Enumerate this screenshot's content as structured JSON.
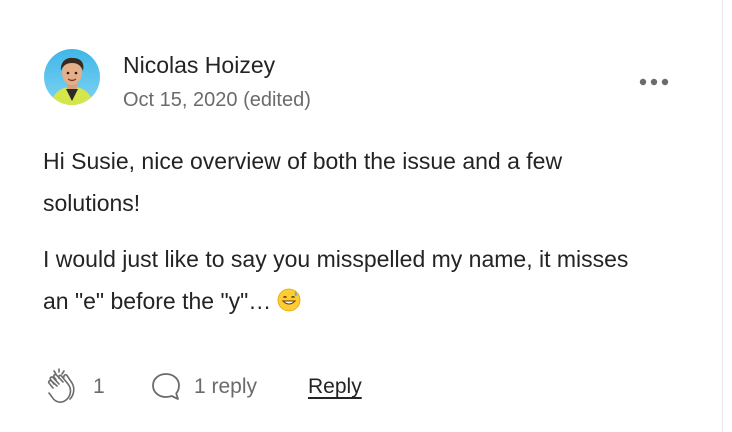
{
  "comment": {
    "author": {
      "name": "Nicolas Hoizey",
      "avatar_icon": "user-avatar-photo"
    },
    "date": "Oct 15, 2020 (edited)",
    "more_icon": "more-horizontal-icon",
    "paragraphs": [
      "Hi Susie, nice overview of both the issue and a few solutions!",
      "I would just like to say you misspelled my name, it misses an \"e\" before the \"y\"…"
    ],
    "trailing_emoji": "grinning-face-with-sweat-emoji"
  },
  "footer": {
    "clap_icon": "clap-icon",
    "clap_count": "1",
    "responses_icon": "speech-bubble-icon",
    "responses_label": "1 reply",
    "reply_label": "Reply"
  },
  "colors": {
    "text_primary": "#242424",
    "text_secondary": "#6b6b6b",
    "divider": "#e6e6e6"
  }
}
